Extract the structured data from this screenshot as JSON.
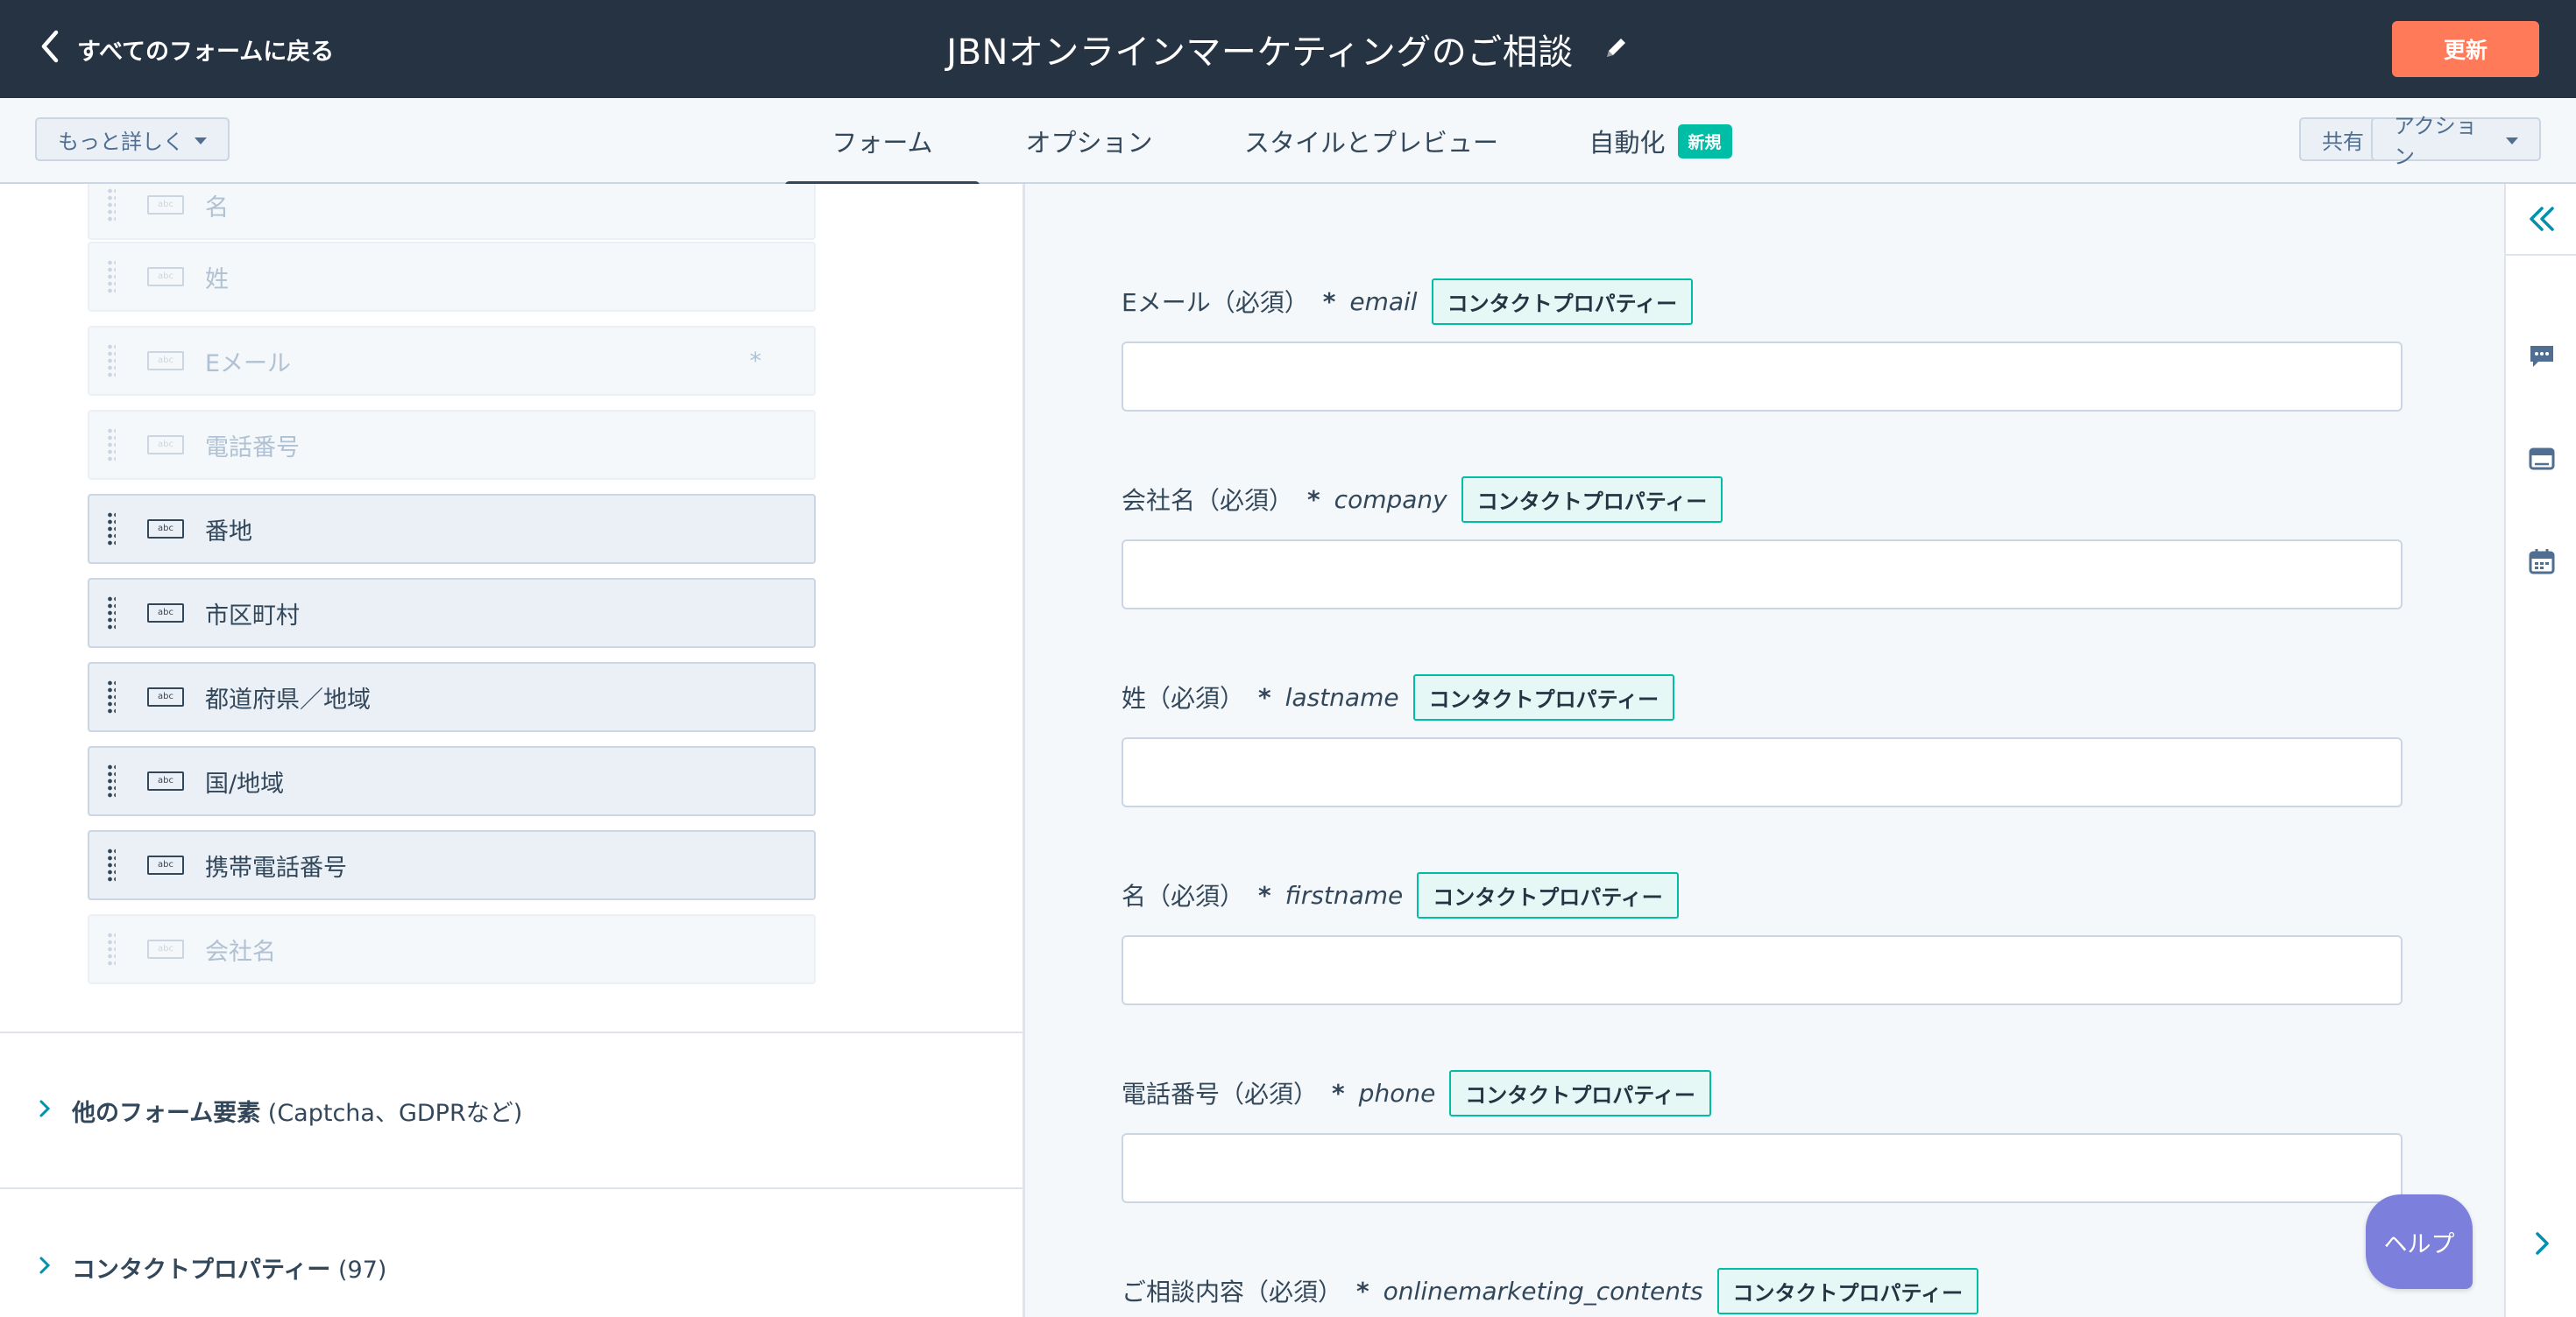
{
  "header": {
    "back_label": "すべてのフォームに戻る",
    "title": "JBNオンラインマーケティングのご相談",
    "update_label": "更新"
  },
  "toolbar": {
    "more_label": "もっと詳しく",
    "share_label": "共有",
    "action_label": "アクション"
  },
  "tabs": [
    {
      "label": "フォーム",
      "active": true
    },
    {
      "label": "オプション"
    },
    {
      "label": "スタイルとプレビュー"
    },
    {
      "label": "自動化",
      "badge": "新規"
    }
  ],
  "left_panel": {
    "fields": [
      {
        "label": "名",
        "disabled": true
      },
      {
        "label": "姓",
        "disabled": true
      },
      {
        "label": "Eメール",
        "disabled": true,
        "required": "*"
      },
      {
        "label": "電話番号",
        "disabled": true
      },
      {
        "label": "番地",
        "disabled": false
      },
      {
        "label": "市区町村",
        "disabled": false
      },
      {
        "label": "都道府県／地域",
        "disabled": false
      },
      {
        "label": "国/地域",
        "disabled": false
      },
      {
        "label": "携帯電話番号",
        "disabled": false
      },
      {
        "label": "会社名",
        "disabled": true
      }
    ],
    "abc_icon_text": "abc",
    "sections": [
      {
        "title": "他のフォーム要素",
        "detail": "(Captcha、GDPRなど)"
      },
      {
        "title": "コンタクトプロパティー",
        "detail": "(97)"
      }
    ]
  },
  "preview": {
    "fields": [
      {
        "label": "Eメール（必須）",
        "star": "*",
        "property": "email",
        "badge": "コンタクトプロパティー"
      },
      {
        "label": "会社名（必須）",
        "star": "*",
        "property": "company",
        "badge": "コンタクトプロパティー"
      },
      {
        "label": "姓（必須）",
        "star": "*",
        "property": "lastname",
        "badge": "コンタクトプロパティー"
      },
      {
        "label": "名（必須）",
        "star": "*",
        "property": "firstname",
        "badge": "コンタクトプロパティー"
      },
      {
        "label": "電話番号（必須）",
        "star": "*",
        "property": "phone",
        "badge": "コンタクトプロパティー"
      },
      {
        "label": "ご相談内容（必須）",
        "star": "*",
        "property": "onlinemarketing_contents",
        "badge": "コンタクトプロパティー"
      }
    ],
    "help_label": "ヘルプ"
  },
  "right_rail": {
    "icons": [
      "collapse-double-chevron-icon",
      "chat-icon",
      "browser-window-icon",
      "calendar-icon",
      "chevron-right-icon"
    ]
  },
  "colors": {
    "topbar": "#253342",
    "accent_orange": "#ff7a59",
    "teal": "#00bda5",
    "help_purple": "#7c80dc"
  }
}
